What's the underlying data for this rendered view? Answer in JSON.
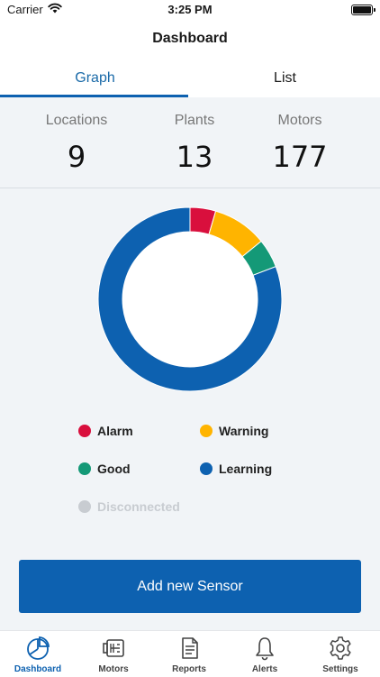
{
  "status_bar": {
    "carrier": "Carrier",
    "time": "3:25 PM"
  },
  "nav": {
    "title": "Dashboard"
  },
  "tabs": [
    {
      "label": "Graph",
      "active": true
    },
    {
      "label": "List",
      "active": false
    }
  ],
  "stats": [
    {
      "label": "Locations",
      "value": "9"
    },
    {
      "label": "Plants",
      "value": "13"
    },
    {
      "label": "Motors",
      "value": "177"
    }
  ],
  "colors": {
    "alarm": "#d90f3d",
    "warning": "#ffb400",
    "good": "#149977",
    "learning": "#0d61b0",
    "disconnected": "#c8ccd1",
    "accent": "#0d61b0"
  },
  "chart_data": {
    "type": "pie",
    "style": "donut",
    "slices": [
      {
        "name": "Alarm",
        "value": 8,
        "color": "#d90f3d"
      },
      {
        "name": "Warning",
        "value": 17,
        "color": "#ffb400"
      },
      {
        "name": "Good",
        "value": 9,
        "color": "#149977"
      },
      {
        "name": "Learning",
        "value": 143,
        "color": "#0d61b0"
      }
    ]
  },
  "legend": [
    {
      "label": "Alarm",
      "color": "#d90f3d",
      "enabled": true
    },
    {
      "label": "Warning",
      "color": "#ffb400",
      "enabled": true
    },
    {
      "label": "Good",
      "color": "#149977",
      "enabled": true
    },
    {
      "label": "Learning",
      "color": "#0d61b0",
      "enabled": true
    },
    {
      "label": "Disconnected",
      "color": "#c8ccd1",
      "enabled": false
    }
  ],
  "add_button": {
    "label": "Add new Sensor"
  },
  "tabbar": [
    {
      "label": "Dashboard",
      "icon": "dashboard-pie-icon",
      "active": true
    },
    {
      "label": "Motors",
      "icon": "motor-icon",
      "active": false
    },
    {
      "label": "Reports",
      "icon": "document-icon",
      "active": false
    },
    {
      "label": "Alerts",
      "icon": "bell-icon",
      "active": false
    },
    {
      "label": "Settings",
      "icon": "gear-icon",
      "active": false
    }
  ]
}
